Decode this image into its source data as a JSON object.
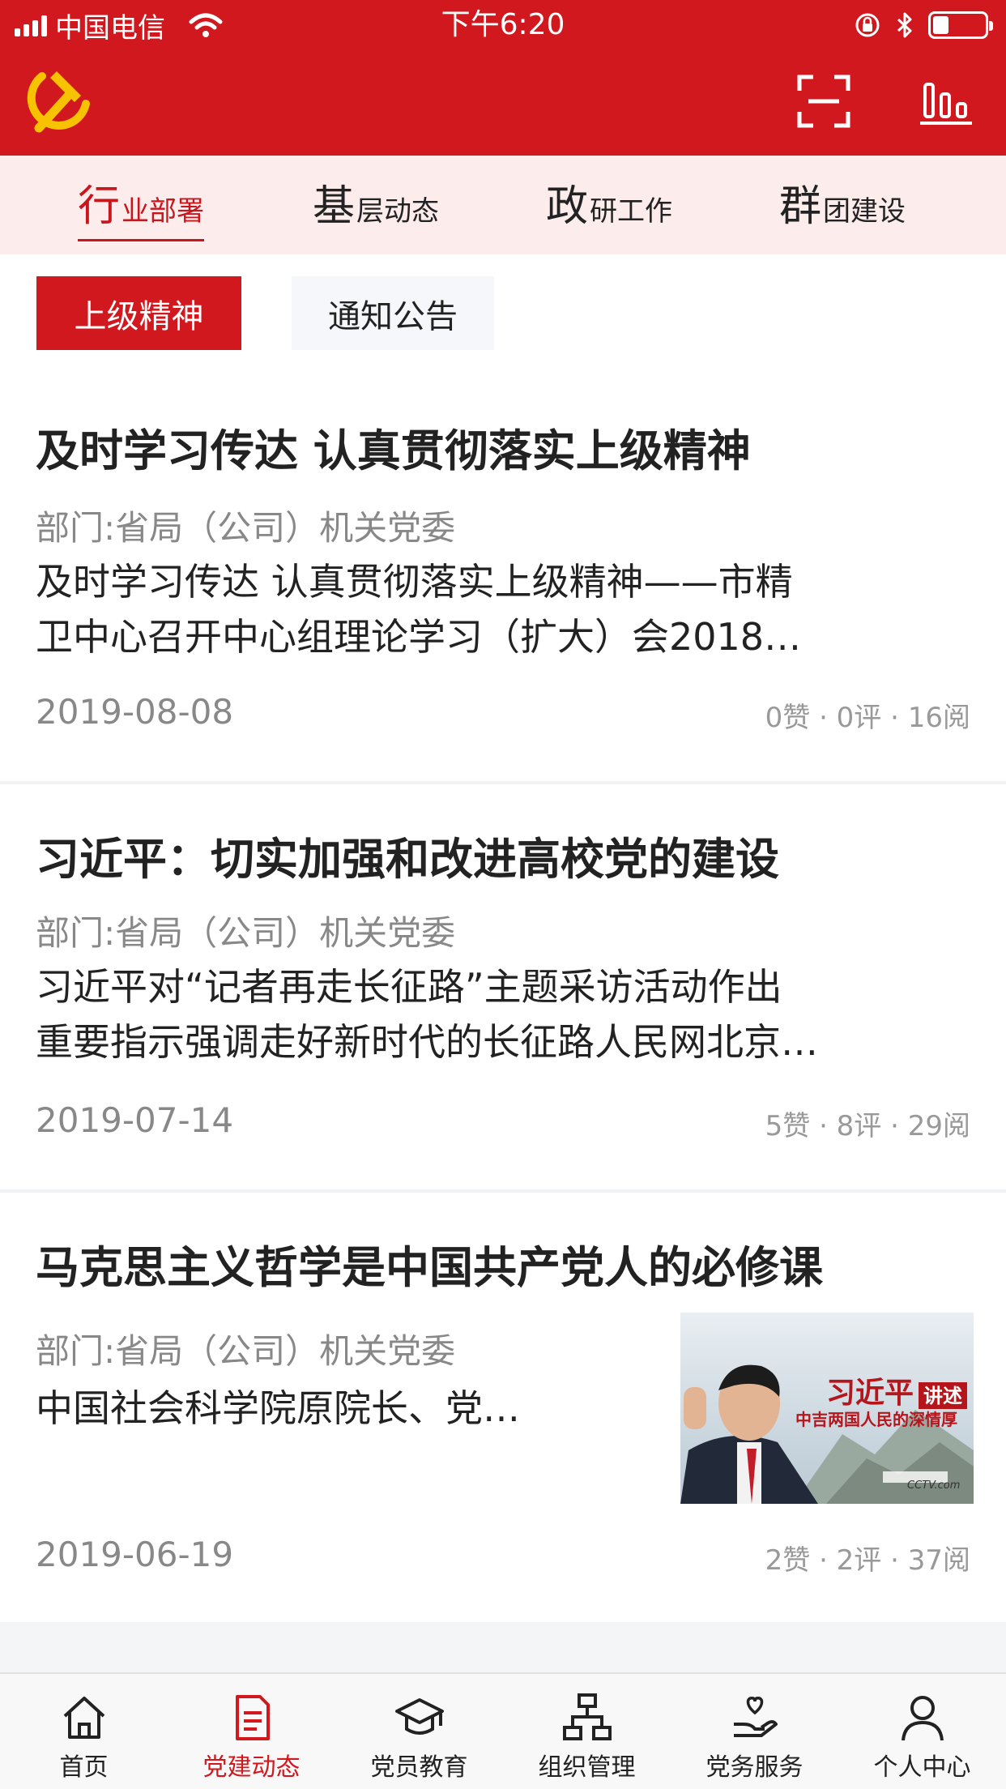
{
  "status_bar": {
    "carrier": "中国电信",
    "time": "下午6:20",
    "battery_level": 0.28
  },
  "header": {
    "logo_icon": "hammer-sickle-icon",
    "scan_icon": "scan-icon",
    "stats_icon": "bar-chart-icon",
    "accent_color": "#d0181e"
  },
  "category_tabs": [
    {
      "big": "行",
      "small": "业部署",
      "active": true
    },
    {
      "big": "基",
      "small": "层动态",
      "active": false
    },
    {
      "big": "政",
      "small": "研工作",
      "active": false
    },
    {
      "big": "群",
      "small": "团建设",
      "active": false
    }
  ],
  "sub_tabs": [
    {
      "label": "上级精神",
      "active": true
    },
    {
      "label": "通知公告",
      "active": false
    }
  ],
  "articles": [
    {
      "title": "及时学习传达 认真贯彻落实上级精神",
      "department": "部门:省局（公司）机关党委",
      "summary_line1": "及时学习传达 认真贯彻落实上级精神——市精",
      "summary_line2": "卫中心召开中心组理论学习（扩大）会2018…",
      "date": "2019-08-08",
      "stats": "0赞 · 0评 · 16阅"
    },
    {
      "title": "习近平：切实加强和改进高校党的建设",
      "department": "部门:省局（公司）机关党委",
      "summary_line1": "习近平对“记者再走长征路”主题采访活动作出",
      "summary_line2": "重要指示强调走好新时代的长征路人民网北京…",
      "date": "2019-07-14",
      "stats": "5赞 · 8评 · 29阅"
    },
    {
      "title": "马克思主义哲学是中国共产党人的必修课",
      "department": "部门:省局（公司）机关党委",
      "summary_line1": "中国社会科学院原院长、党…",
      "date": "2019-06-19",
      "stats": "2赞 · 2评 · 37阅",
      "thumbnail": {
        "headline": "习近平",
        "tag": "讲述",
        "subline": "中吉两国人民的深情厚",
        "watermark": "CCTV.com"
      }
    }
  ],
  "bottom_tabs": [
    {
      "label": "首页",
      "icon": "home-icon",
      "active": false
    },
    {
      "label": "党建动态",
      "icon": "document-icon",
      "active": true
    },
    {
      "label": "党员教育",
      "icon": "graduation-cap-icon",
      "active": false
    },
    {
      "label": "组织管理",
      "icon": "org-chart-icon",
      "active": false
    },
    {
      "label": "党务服务",
      "icon": "heart-hand-icon",
      "active": false
    },
    {
      "label": "个人中心",
      "icon": "person-icon",
      "active": false
    }
  ]
}
